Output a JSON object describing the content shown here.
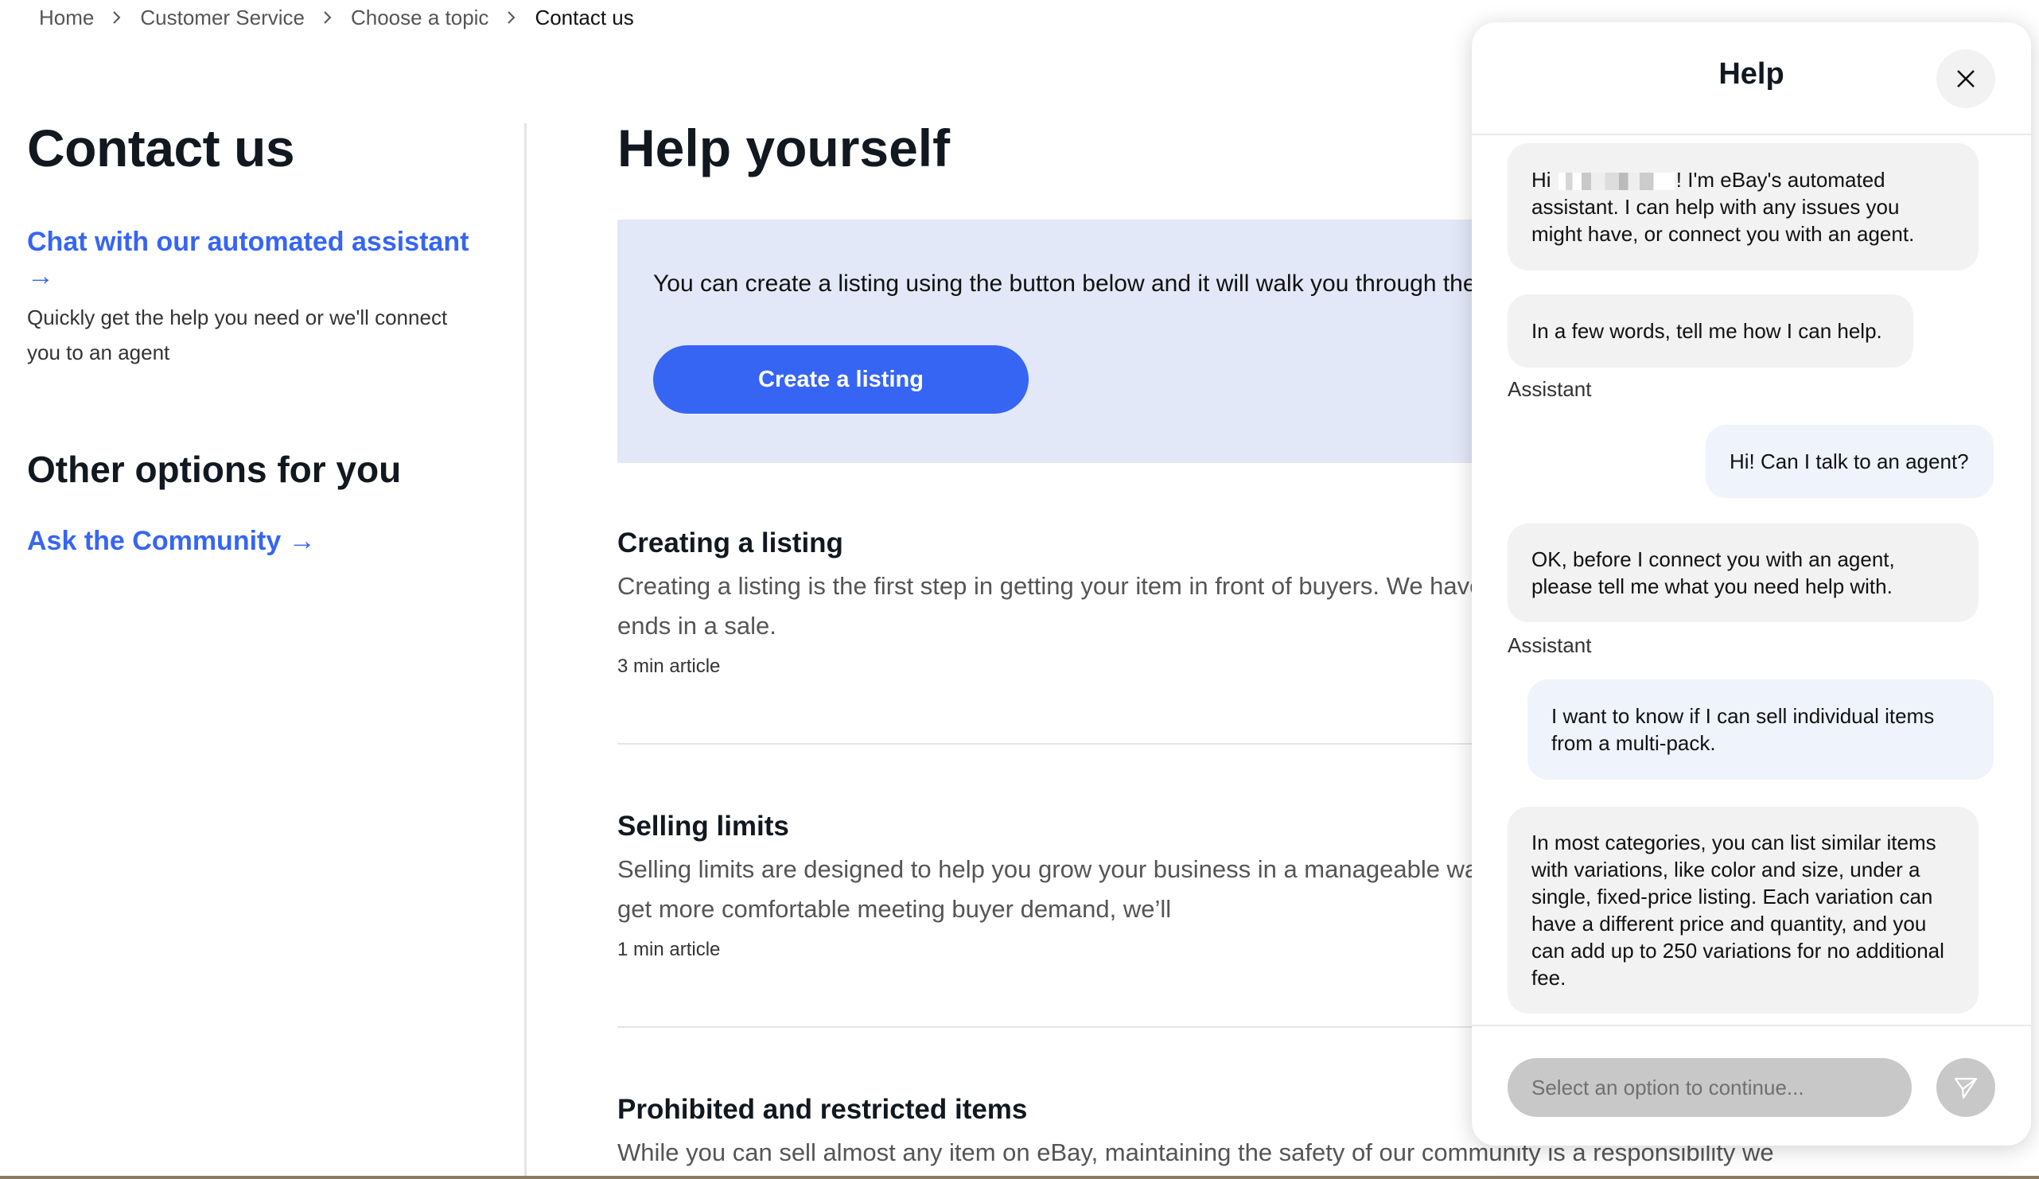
{
  "breadcrumb": {
    "items": [
      "Home",
      "Customer Service",
      "Choose a topic",
      "Contact us"
    ]
  },
  "left": {
    "title": "Contact us",
    "chat_link": "Chat with our automated assistant",
    "chat_arrow": "→",
    "chat_desc": "Quickly get the help you need or we'll connect you to an agent",
    "other_title": "Other options for you",
    "community_link": "Ask the Community →"
  },
  "main": {
    "title": "Help yourself",
    "banner_text": "You can create a listing using the button below and it will walk you through the",
    "create_button": "Create a listing",
    "articles": [
      {
        "title": "Creating a listing",
        "desc": "Creating a listing is the first step in getting your item in front of buyers. We have help make sure your listing ends in a sale.",
        "meta": "3 min article"
      },
      {
        "title": "Selling limits",
        "desc": "Selling limits are designed to help you grow your business in a manageable way buyers great service. As you get more comfortable meeting buyer demand, we’ll",
        "meta": "1 min article"
      },
      {
        "title": "Prohibited and restricted items",
        "desc": "While you can sell almost any item on eBay, maintaining the safety of our community is a responsibility we take",
        "meta": ""
      }
    ],
    "bottom_arrow": "→"
  },
  "help_panel": {
    "title": "Help",
    "close_icon": "close-icon",
    "messages": [
      {
        "role": "bot",
        "pre": "Hi ",
        "post": "! I'm eBay's automated assistant. I can help with any issues you might have, or connect you with an agent."
      },
      {
        "role": "bot",
        "text": "In a few words, tell me how I can help."
      },
      {
        "role": "label",
        "text": "Assistant"
      },
      {
        "role": "user",
        "text": "Hi! Can I talk to an agent?"
      },
      {
        "role": "bot",
        "text": "OK, before I connect you with an agent, please tell me what you need help with."
      },
      {
        "role": "label",
        "text": "Assistant"
      },
      {
        "role": "user",
        "text": "I want to know if I can sell individual items from a multi-pack."
      },
      {
        "role": "bot",
        "text": "In most categories, you can list similar items with variations, like color and size, under a single, fixed-price listing. Each variation can have a different price and quantity, and you can add up to 250 variations for no additional fee."
      }
    ],
    "input_placeholder": "Select an option to continue...",
    "send_icon": "send-icon"
  },
  "colors": {
    "link": "#3665f3",
    "button": "#3665f3",
    "banner_bg": "#e3e8f8",
    "user_bubble": "#eef3fc",
    "bot_bubble": "#f2f2f2"
  }
}
